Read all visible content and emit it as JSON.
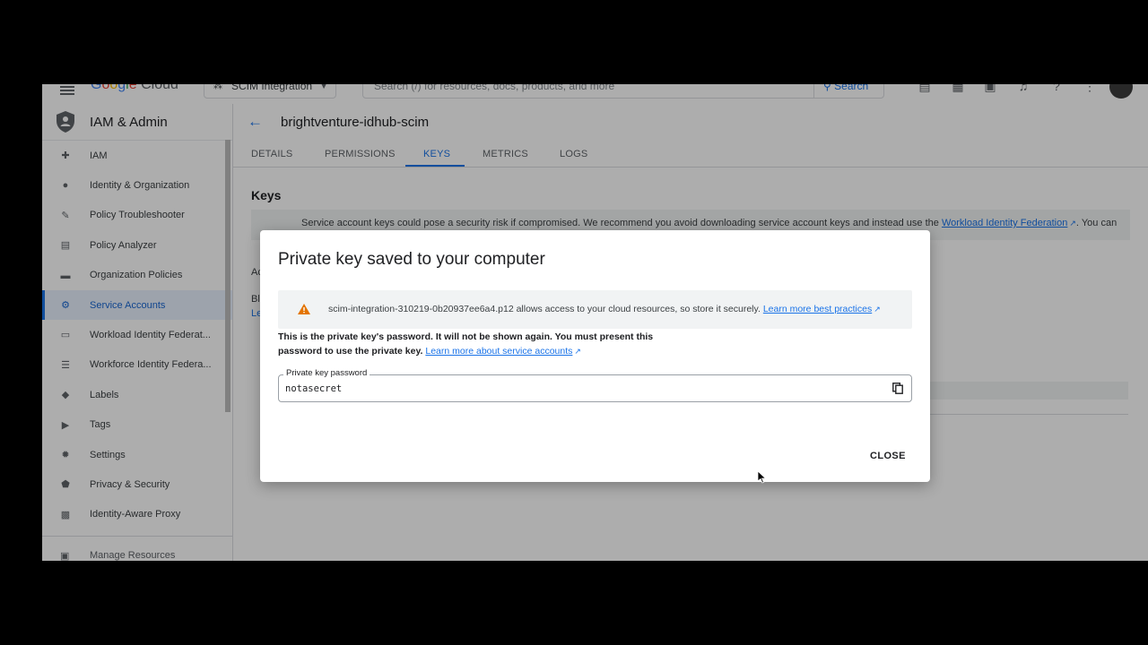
{
  "topbar": {
    "logo": {
      "g": "G",
      "o1": "o",
      "o2": "o",
      "g2": "g",
      "l": "l",
      "e": "e",
      "cloud": "Cloud"
    },
    "project": "SCIM Integration",
    "search_placeholder": "Search (/) for resources, docs, products, and more",
    "search_button": "Search"
  },
  "sidebar": {
    "title": "IAM & Admin",
    "items": [
      {
        "label": "IAM",
        "icon": "person-add-icon"
      },
      {
        "label": "Identity & Organization",
        "icon": "account-circle-icon"
      },
      {
        "label": "Policy Troubleshooter",
        "icon": "wrench-icon"
      },
      {
        "label": "Policy Analyzer",
        "icon": "document-search-icon"
      },
      {
        "label": "Organization Policies",
        "icon": "article-icon"
      },
      {
        "label": "Service Accounts",
        "icon": "service-account-icon",
        "active": true
      },
      {
        "label": "Workload Identity Federat...",
        "icon": "id-card-icon"
      },
      {
        "label": "Workforce Identity Federa...",
        "icon": "list-icon"
      },
      {
        "label": "Labels",
        "icon": "label-icon"
      },
      {
        "label": "Tags",
        "icon": "tag-icon"
      },
      {
        "label": "Settings",
        "icon": "gear-icon"
      },
      {
        "label": "Privacy & Security",
        "icon": "shield-icon"
      },
      {
        "label": "Identity-Aware Proxy",
        "icon": "proxy-icon"
      }
    ],
    "footer": "Manage Resources"
  },
  "main": {
    "title": "brightventure-idhub-scim",
    "tabs": [
      "DETAILS",
      "PERMISSIONS",
      "KEYS",
      "METRICS",
      "LOGS"
    ],
    "active_tab": "KEYS",
    "section_title": "Keys",
    "banner": {
      "text": "Service account keys could pose a security risk if compromised. We recommend you avoid downloading service account keys and instead use the",
      "link": "Workload Identity Federation",
      "tail": ". You can"
    },
    "fragments": {
      "ad": "Ac",
      "bl": "Bl",
      "le": "Le"
    }
  },
  "dialog": {
    "title": "Private key saved to your computer",
    "warning_text": "scim-integration-310219-0b20937ee6a4.p12 allows access to your cloud resources, so store it securely.",
    "warning_link": "Learn more best practices",
    "desc_bold": "This is the private key's password. It will not be shown again. You must present this password to use the private key.",
    "desc_link": "Learn more about service accounts",
    "field_label": "Private key password",
    "field_value": "notasecret",
    "close_label": "CLOSE"
  },
  "colors": {
    "accent": "#1a73e8",
    "warning": "#e37400",
    "active_bg": "#e8f0fe"
  }
}
